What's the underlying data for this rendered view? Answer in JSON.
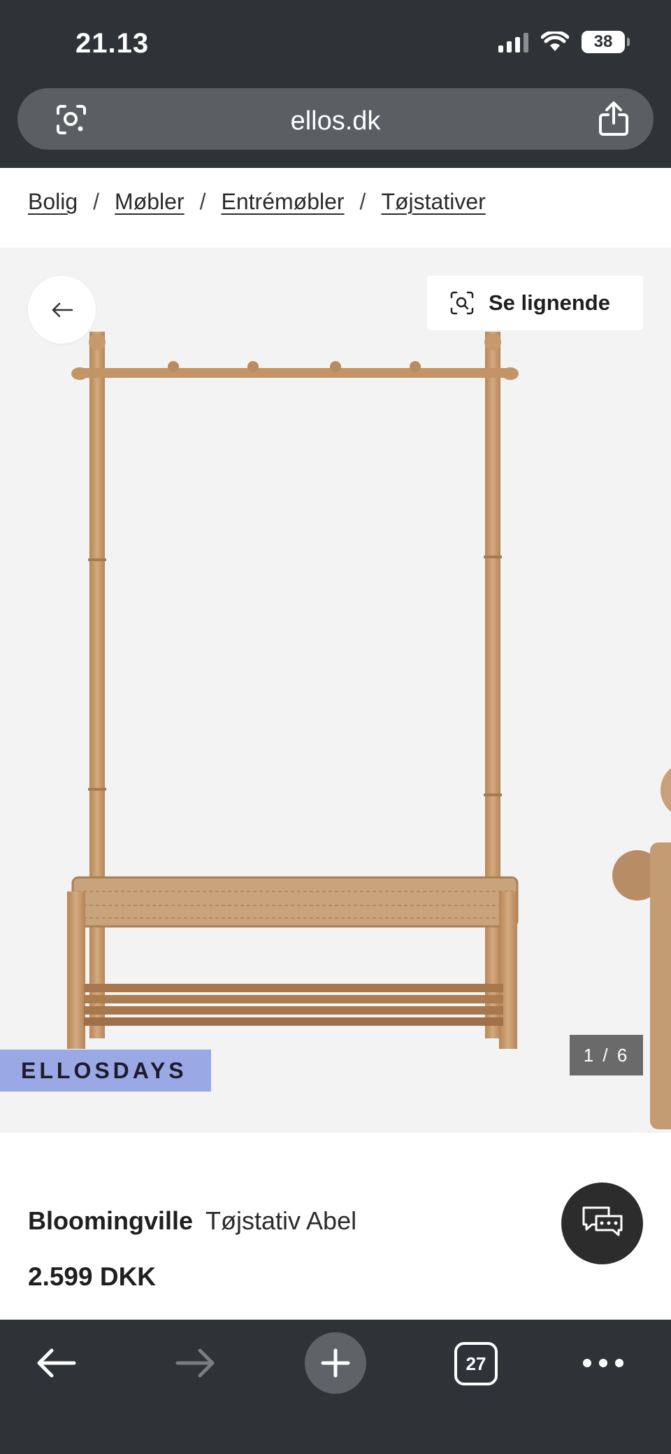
{
  "status_bar": {
    "time": "21.13",
    "battery": "38",
    "icons": [
      "signal-icon",
      "wifi-icon",
      "battery-icon"
    ]
  },
  "browser": {
    "url": "ellos.dk",
    "icons": [
      "lens-icon",
      "share-icon"
    ]
  },
  "breadcrumb": {
    "items": [
      {
        "label": "Bolig"
      },
      {
        "label": "Møbler"
      },
      {
        "label": "Entrémøbler"
      },
      {
        "label": "Tøjstativer"
      }
    ],
    "separator": "/"
  },
  "gallery": {
    "similar_label": "Se lignende",
    "promo_badge": "ELLOSDAYS",
    "counter": "1 / 6",
    "current_image": 1,
    "total_images": 6,
    "background_color": "#f3f3f4",
    "promo_color": "#9aa8e6"
  },
  "product": {
    "brand": "Bloomingville",
    "name": "Tøjstativ Abel",
    "price": "2.599 DKK"
  },
  "toolbar": {
    "tab_count": "27",
    "icons": [
      "back-arrow-icon",
      "forward-arrow-icon",
      "plus-icon",
      "tabs-icon",
      "more-icon"
    ]
  },
  "colors": {
    "browser_chrome": "#2f3236",
    "url_field": "#5b5f63",
    "chat_button": "#2c2c2c",
    "wood": "#c69a6c"
  }
}
